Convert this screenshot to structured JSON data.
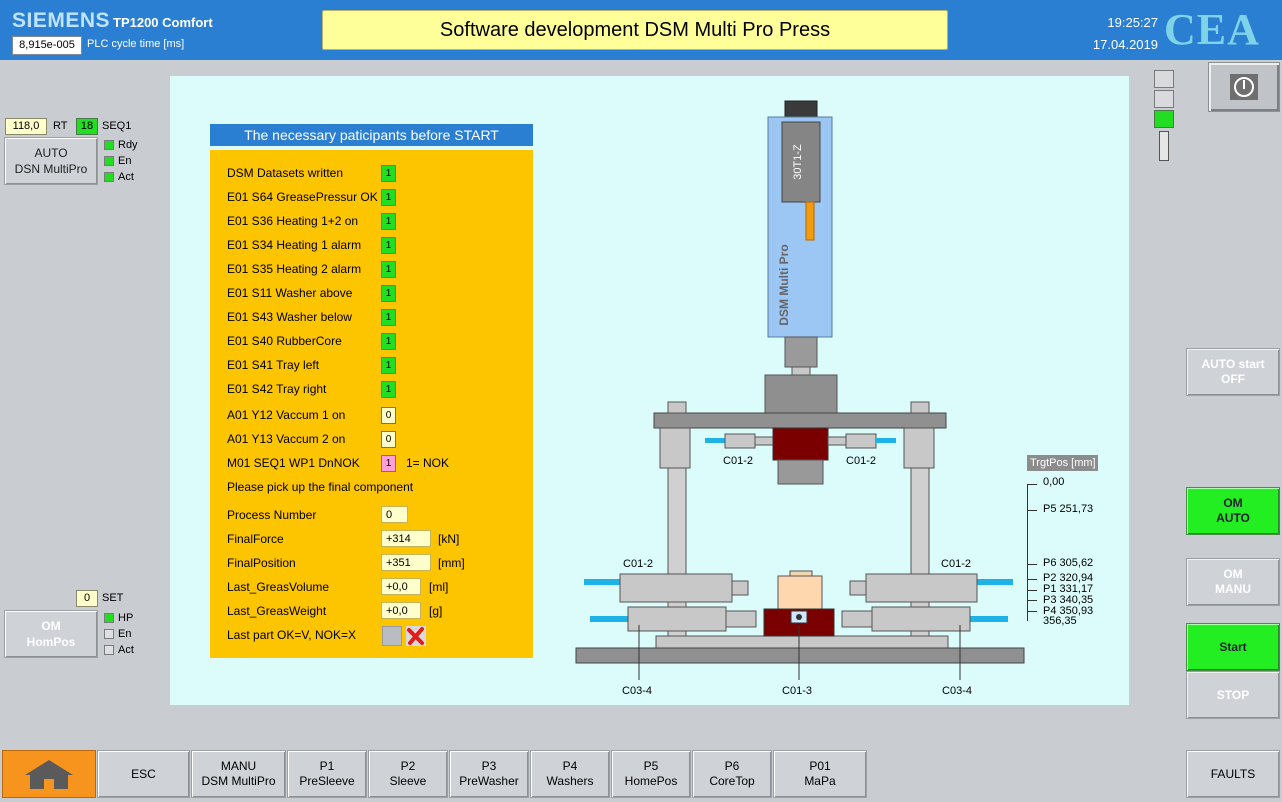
{
  "header": {
    "brand": "SIEMENS",
    "model": "TP1200 Comfort",
    "cycle_value": "8,915e-005",
    "cycle_label": "PLC cycle time [ms]",
    "title": "Software development DSM Multi Pro Press",
    "time": "19:25:27",
    "date": "17.04.2019",
    "logo": "CEA"
  },
  "left": {
    "rt_value": "118,0",
    "rt_label": "RT",
    "seq_value": "18",
    "seq_label": "SEQ1",
    "auto_button": "AUTO\nDSN MultiPro",
    "auto_button_line1": "AUTO",
    "auto_button_line2": "DSN MultiPro",
    "auto_leds": [
      {
        "label": "Rdy",
        "state": "on"
      },
      {
        "label": "En",
        "state": "on"
      },
      {
        "label": "Act",
        "state": "on"
      }
    ],
    "set_value": "0",
    "set_label": "SET",
    "om_button_line1": "OM",
    "om_button_line2": "HomPos",
    "om_leds": [
      {
        "label": "HP",
        "state": "on"
      },
      {
        "label": "En",
        "state": "off"
      },
      {
        "label": "Act",
        "state": "off"
      }
    ]
  },
  "table": {
    "heading": "The necessary paticipants before START",
    "rows": [
      {
        "label": "DSM Datasets written",
        "value": "1"
      },
      {
        "label": "E01 S64 GreasePressur OK",
        "value": "1"
      },
      {
        "label": "E01 S36 Heating 1+2 on",
        "value": "1"
      },
      {
        "label": "E01 S34 Heating 1 alarm",
        "value": "1"
      },
      {
        "label": "E01 S35 Heating 2 alarm",
        "value": "1"
      },
      {
        "label": "E01 S11 Washer above",
        "value": "1"
      },
      {
        "label": "E01 S43 Washer below",
        "value": "1"
      },
      {
        "label": "E01 S40 RubberCore",
        "value": "1"
      },
      {
        "label": "E01 S41 Tray left",
        "value": "1"
      },
      {
        "label": "E01 S42 Tray right",
        "value": "1"
      },
      {
        "label": "A01 Y12 Vaccum 1 on",
        "value": "0"
      },
      {
        "label": "A01 Y13 Vaccum 2 on",
        "value": "0"
      },
      {
        "label": "M01 SEQ1 WP1 DnNOK",
        "value": "1",
        "note": "1= NOK"
      }
    ],
    "pickup_text": "Please pick up the final component",
    "process_label": "Process Number",
    "process_value": "0",
    "measures": [
      {
        "label": "FinalForce",
        "value": "+314",
        "unit": "[kN]"
      },
      {
        "label": "FinalPosition",
        "value": "+351",
        "unit": "[mm]"
      },
      {
        "label": "Last_GreasVolume",
        "value": "+0,0",
        "unit": "[ml]"
      },
      {
        "label": "Last_GreasWeight",
        "value": "+0,0",
        "unit": "[g]"
      }
    ],
    "last_part_label": "Last part OK=V,  NOK=X"
  },
  "machine": {
    "sensor_label": "30T1-Z",
    "press_label": "DSM Multi Pro",
    "labels": {
      "c01_2": "C01-2",
      "c01_3": "C01-3",
      "c03_4": "C03-4"
    },
    "target_title": "TrgtPos [mm]",
    "positions": [
      {
        "name": "",
        "value": "0,00"
      },
      {
        "name": "P5",
        "value": "251,73"
      },
      {
        "name": "P6",
        "value": "305,62"
      },
      {
        "name": "P2",
        "value": "320,94"
      },
      {
        "name": "P1",
        "value": "331,17"
      },
      {
        "name": "P3",
        "value": "340,35"
      },
      {
        "name": "P4",
        "value": "350,93"
      },
      {
        "name": "",
        "value": "356,35"
      }
    ]
  },
  "right": {
    "auto_start": "AUTO start\nOFF",
    "auto_start_l1": "AUTO start",
    "auto_start_l2": "OFF",
    "om_auto_l1": "OM",
    "om_auto_l2": "AUTO",
    "om_manu_l1": "OM",
    "om_manu_l2": "MANU",
    "start": "Start",
    "stop": "STOP"
  },
  "bottom": {
    "buttons": [
      {
        "l1": "",
        "l2": "ESC"
      },
      {
        "l1": "MANU",
        "l2": "DSM MultiPro"
      },
      {
        "l1": "P1",
        "l2": "PreSleeve"
      },
      {
        "l1": "P2",
        "l2": "Sleeve"
      },
      {
        "l1": "P3",
        "l2": "PreWasher"
      },
      {
        "l1": "P4",
        "l2": "Washers"
      },
      {
        "l1": "P5",
        "l2": "HomePos"
      },
      {
        "l1": "P6",
        "l2": "CoreTop"
      },
      {
        "l1": "P01",
        "l2": "MaPa"
      }
    ],
    "faults": "FAULTS"
  },
  "colors": {
    "header_blue": "#2a7fd2",
    "table_bg": "#fdc400",
    "canvas_bg": "#dcfcfc",
    "status_green": "#22ee22",
    "press_blue": "#9cc7f4",
    "part_red": "#7a0000"
  }
}
